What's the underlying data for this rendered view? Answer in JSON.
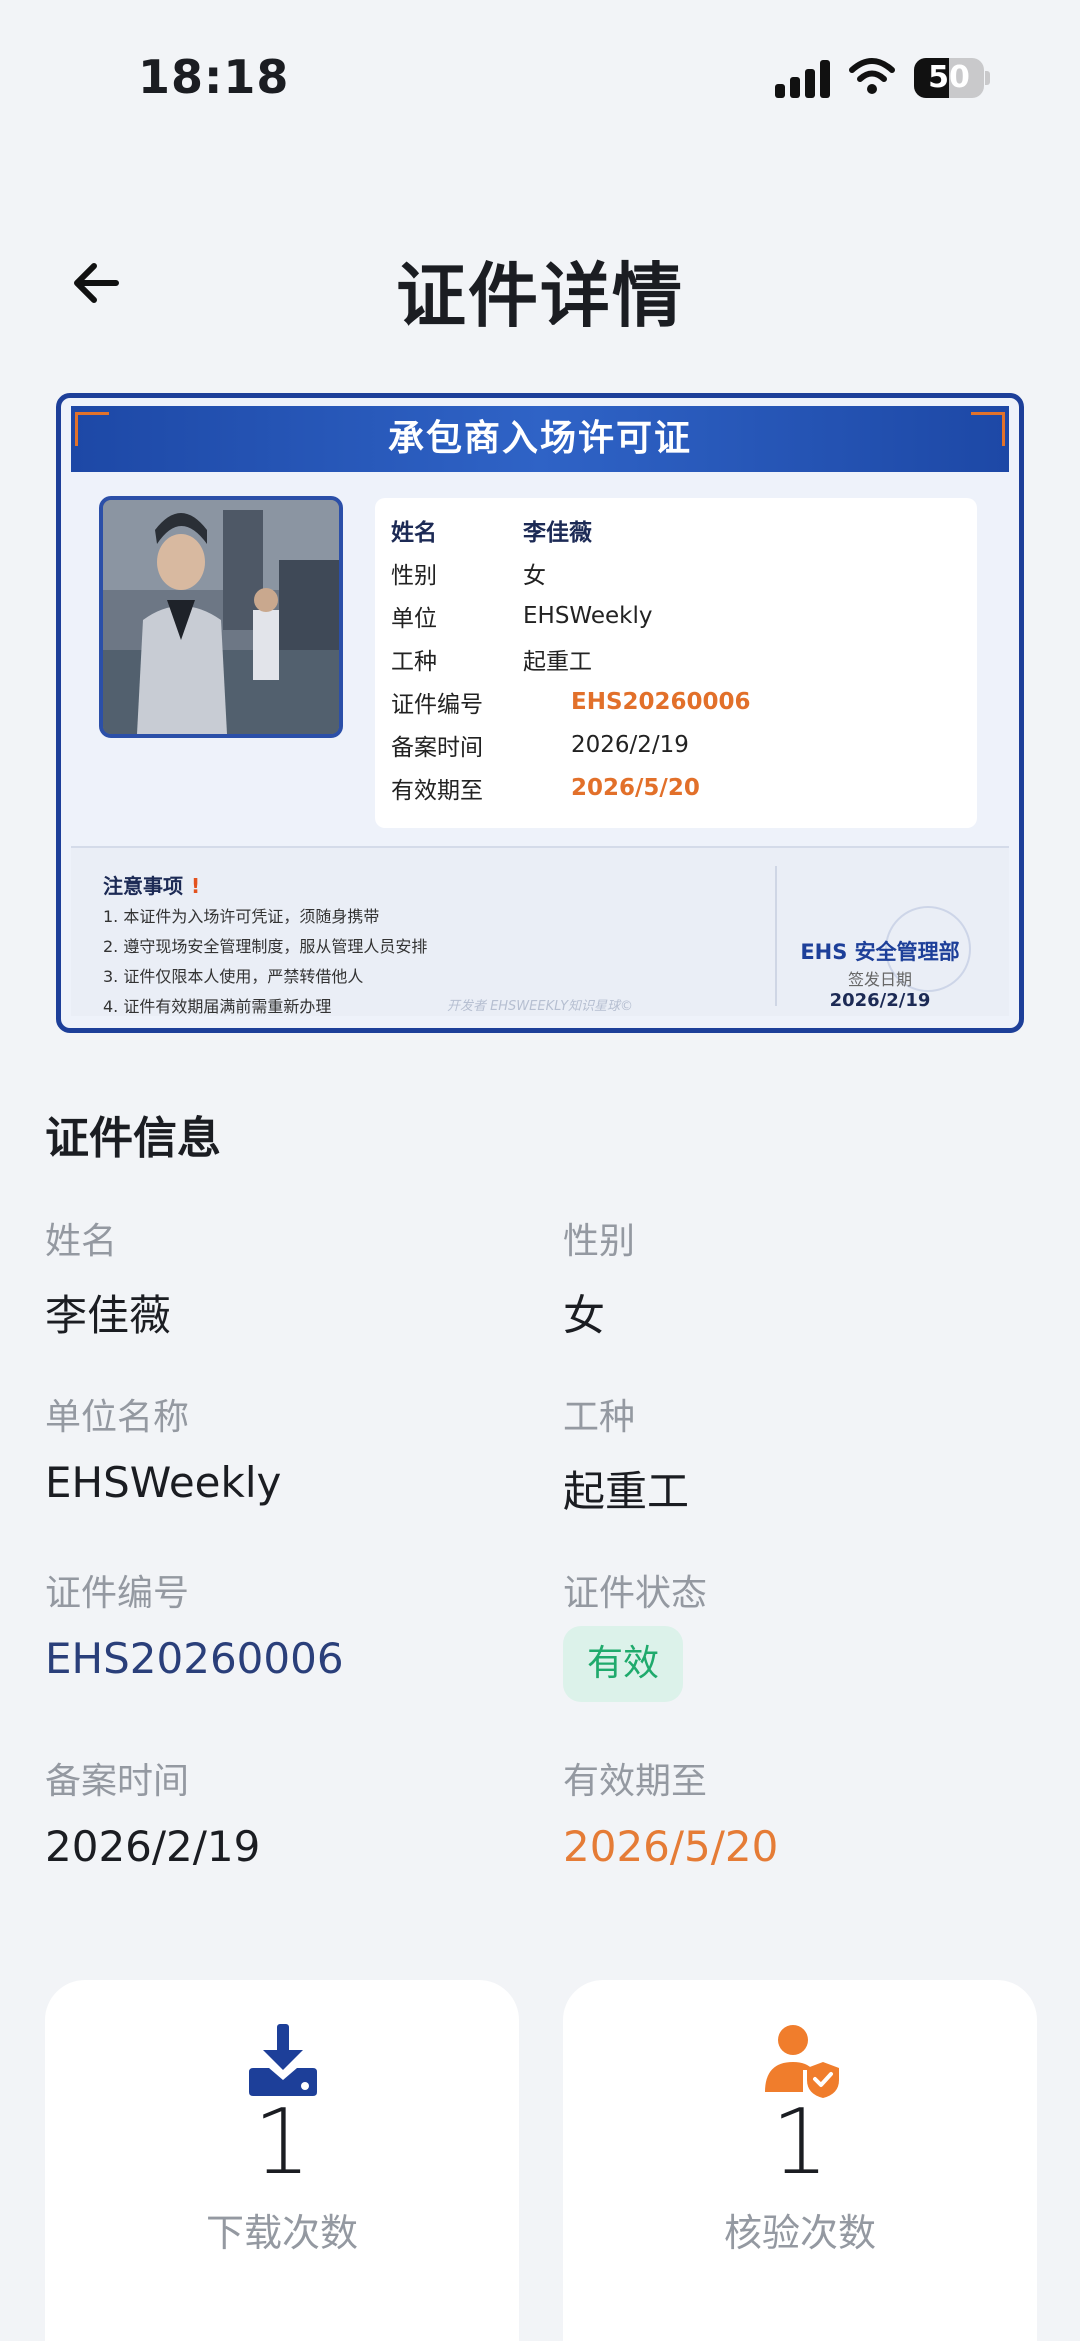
{
  "status_bar": {
    "time": "18:18",
    "battery": "50",
    "battery_level": 0.5
  },
  "header": {
    "title": "证件详情"
  },
  "certificate": {
    "title": "承包商入场许可证",
    "fields": [
      {
        "label": "姓名",
        "value": "李佳薇"
      },
      {
        "label": "性别",
        "value": "女"
      },
      {
        "label": "单位",
        "value": "EHSWeekly"
      },
      {
        "label": "工种",
        "value": "起重工"
      },
      {
        "label": "证件编号",
        "value": "EHS20260006"
      },
      {
        "label": "备案时间",
        "value": "2026/2/19"
      },
      {
        "label": "有效期至",
        "value": "2026/5/20"
      }
    ],
    "notice_title": "注意事项",
    "notice_mark": "!",
    "notices": [
      "1. 本证件为入场许可凭证，须随身携带",
      "2. 遵守现场安全管理制度，服从管理人员安排",
      "3. 证件仅限本人使用，严禁转借他人",
      "4. 证件有效期届满前需重新办理"
    ],
    "seal_org": "EHS 安全管理部",
    "seal_date_label": "签发日期",
    "seal_date": "2026/2/19",
    "watermark": "开发者 EHSWEEKLY知识星球©"
  },
  "info": {
    "section_title": "证件信息",
    "name_label": "姓名",
    "name_value": "李佳薇",
    "gender_label": "性别",
    "gender_value": "女",
    "company_label": "单位名称",
    "company_value": "EHSWeekly",
    "job_label": "工种",
    "job_value": "起重工",
    "cert_no_label": "证件编号",
    "cert_no_value": "EHS20260006",
    "status_label": "证件状态",
    "status_value": "有效",
    "filing_label": "备案时间",
    "filing_value": "2026/2/19",
    "expiry_label": "有效期至",
    "expiry_value": "2026/5/20"
  },
  "stats": {
    "download_count": "1",
    "download_label": "下载次数",
    "verify_count": "1",
    "verify_label": "核验次数"
  },
  "colors": {
    "brand_blue": "#1d3f99",
    "accent_orange": "#e57c36",
    "valid_green": "#1faa6c"
  }
}
